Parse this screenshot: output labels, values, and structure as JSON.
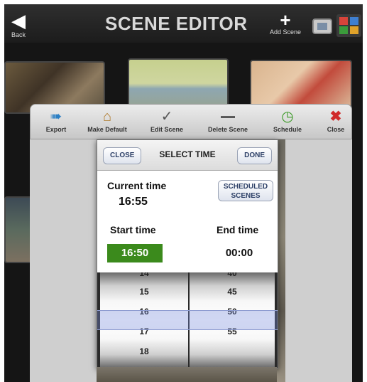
{
  "header": {
    "title": "SCENE EDITOR",
    "back_label": "Back",
    "add_scene_label": "Add Scene"
  },
  "toolbar": {
    "items": [
      {
        "label": "Export",
        "icon": "export-icon"
      },
      {
        "label": "Make Default",
        "icon": "house-icon"
      },
      {
        "label": "Edit Scene",
        "icon": "wrench-icon"
      },
      {
        "label": "Delete Scene",
        "icon": "minus-icon"
      },
      {
        "label": "Schedule",
        "icon": "clock-icon"
      },
      {
        "label": "Close",
        "icon": "close-icon"
      }
    ],
    "colors": {
      "export": "#2b7fc4",
      "house": "#b07a2a",
      "clock": "#3e9b2a",
      "close": "#d02a2a"
    }
  },
  "dialog": {
    "close_label": "CLOSE",
    "title": "SELECT TIME",
    "done_label": "DONE",
    "current_time_label": "Current time",
    "current_time_value": "16:55",
    "scheduled_scenes_label": "SCHEDULED SCENES",
    "start_time_label": "Start time",
    "start_time_value": "16:50",
    "end_time_label": "End time",
    "end_time_value": "00:00",
    "start_color": "#3b8a1c"
  },
  "picker": {
    "hours": [
      "14",
      "15",
      "16",
      "17",
      "18"
    ],
    "minutes": [
      "40",
      "45",
      "50",
      "55"
    ],
    "selected_hour": "16",
    "selected_minute": "50"
  }
}
